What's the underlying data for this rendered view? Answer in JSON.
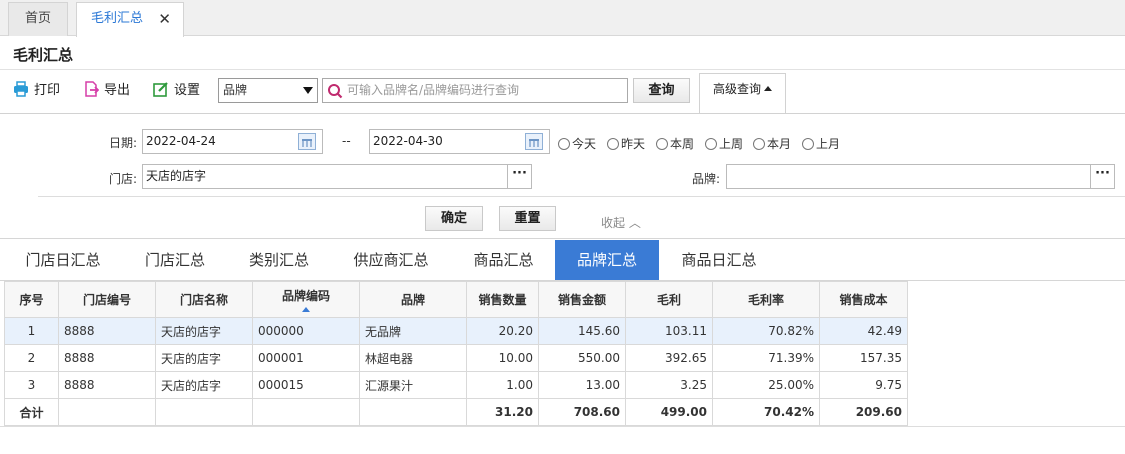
{
  "tabs": {
    "home": "首页",
    "active": "毛利汇总",
    "close": "✕"
  },
  "page_title": "毛利汇总",
  "toolbar": {
    "print": "打印",
    "export": "导出",
    "settings": "设置",
    "search_type": "品牌",
    "search_placeholder": "可输入品牌名/品牌编码进行查询",
    "query": "查询",
    "advanced": "高级查询"
  },
  "filters": {
    "date_label": "日期:",
    "date_from": "2022-04-24",
    "date_sep": "--",
    "date_to": "2022-04-30",
    "ranges": [
      "今天",
      "昨天",
      "本周",
      "上周",
      "本月",
      "上月"
    ],
    "store_label": "门店:",
    "store_value": "天店的店字",
    "brand_label": "品牌:",
    "brand_value": "",
    "more": "···",
    "confirm": "确定",
    "reset": "重置",
    "collapse": "收起 ︿"
  },
  "report_tabs": [
    "门店日汇总",
    "门店汇总",
    "类别汇总",
    "供应商汇总",
    "商品汇总",
    "品牌汇总",
    "商品日汇总"
  ],
  "table": {
    "headers": [
      "序号",
      "门店编号",
      "门店名称",
      "品牌编码",
      "品牌",
      "销售数量",
      "销售金额",
      "毛利",
      "毛利率",
      "销售成本"
    ],
    "rows": [
      [
        "1",
        "8888",
        "天店的店字",
        "000000",
        "无品牌",
        "20.20",
        "145.60",
        "103.11",
        "70.82%",
        "42.49"
      ],
      [
        "2",
        "8888",
        "天店的店字",
        "000001",
        "林超电器",
        "10.00",
        "550.00",
        "392.65",
        "71.39%",
        "157.35"
      ],
      [
        "3",
        "8888",
        "天店的店字",
        "000015",
        "汇源果汁",
        "1.00",
        "13.00",
        "3.25",
        "25.00%",
        "9.75"
      ]
    ],
    "total": [
      "合计",
      "",
      "",
      "",
      "",
      "31.20",
      "708.60",
      "499.00",
      "70.42%",
      "209.60"
    ]
  },
  "colors": {
    "accent": "#3a7bd5",
    "tab_active_text": "#2b78d6",
    "selected_row": "#e8f1fc"
  }
}
